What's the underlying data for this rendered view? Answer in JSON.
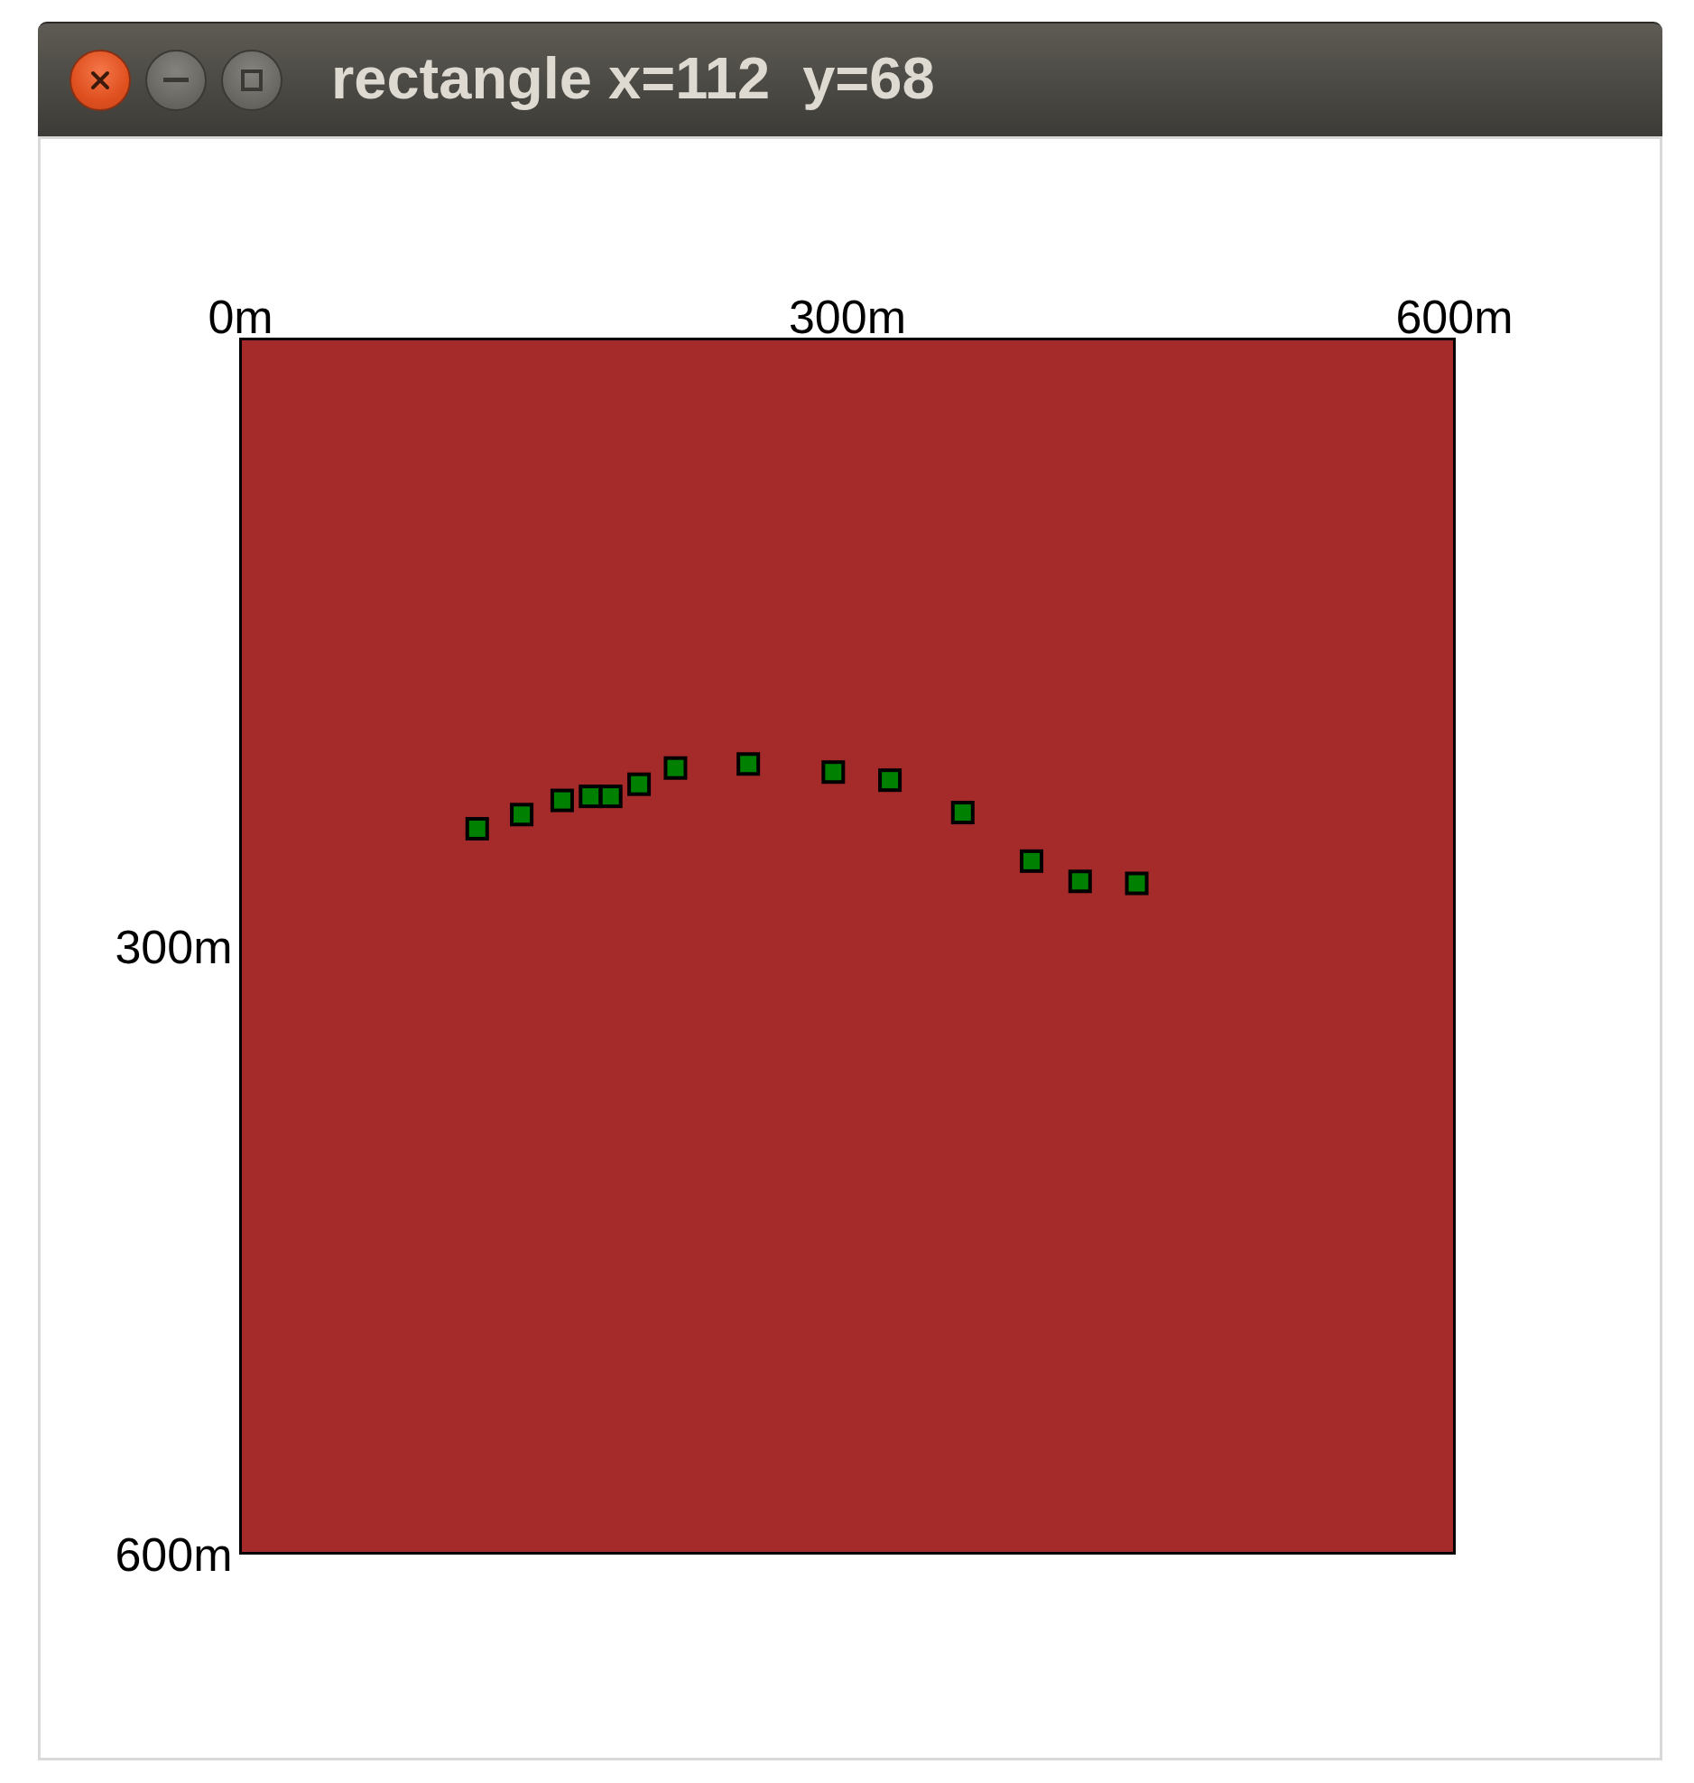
{
  "window": {
    "title": "rectangle x=112  y=68"
  },
  "plot": {
    "chart_data": {
      "type": "scatter",
      "x": [
        117,
        139,
        159,
        173,
        183,
        197,
        215,
        251,
        293,
        321,
        357,
        391,
        415,
        443
      ],
      "series": [
        {
          "color": "#008000",
          "values": [
            242,
            235,
            228,
            226,
            226,
            220,
            212,
            210,
            214,
            218,
            234,
            258,
            268,
            269
          ]
        }
      ],
      "xlim": [
        0,
        600
      ],
      "ylim": [
        600,
        0
      ],
      "xticks": [
        {
          "value": 0,
          "label": "0m"
        },
        {
          "value": 300,
          "label": "300m"
        },
        {
          "value": 600,
          "label": "600m"
        }
      ],
      "yticks": [
        {
          "value": 300,
          "label": "300m"
        },
        {
          "value": 600,
          "label": "600m"
        }
      ]
    }
  }
}
